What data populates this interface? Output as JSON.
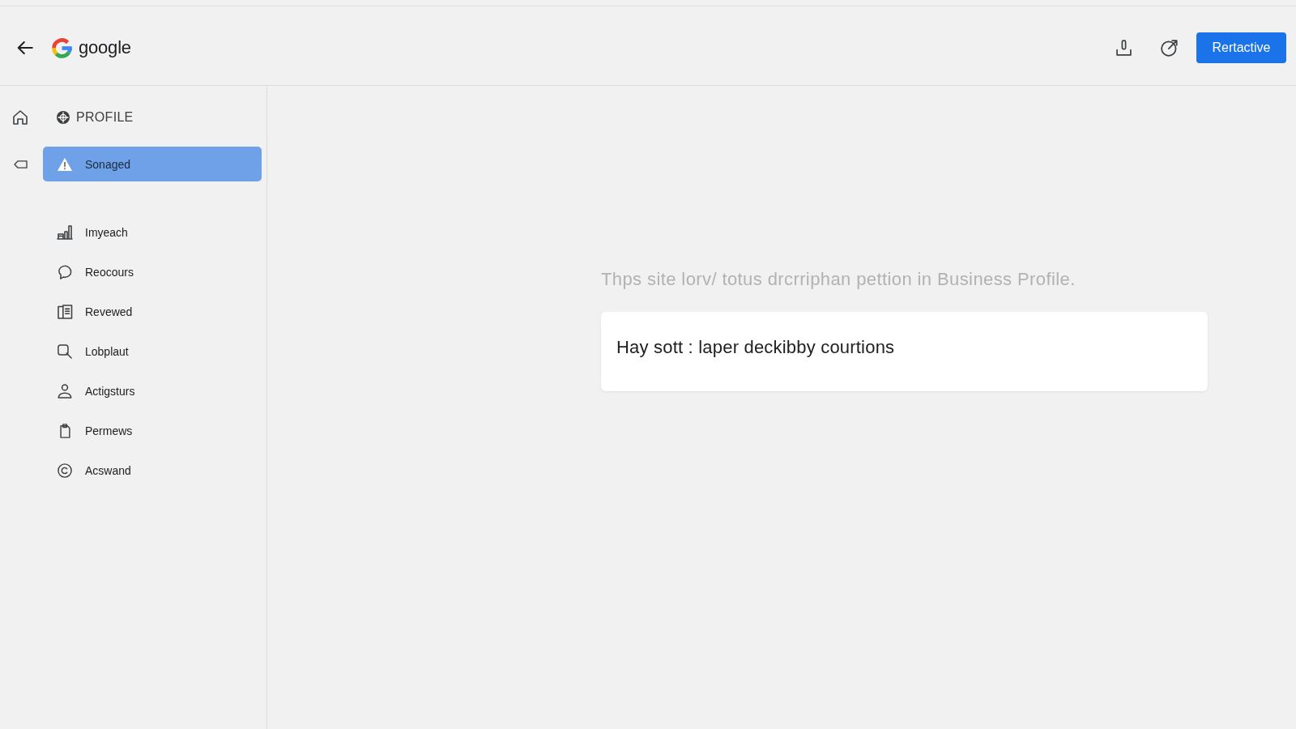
{
  "header": {
    "brand": "google",
    "primary_button": "Rertactive"
  },
  "sidebar": {
    "heading": "PROFILE",
    "items": [
      {
        "label": "Sonaged",
        "selected": true
      },
      {
        "label": "Imyeach",
        "selected": false
      },
      {
        "label": "Reocours",
        "selected": false
      },
      {
        "label": "Revewed",
        "selected": false
      },
      {
        "label": "Lobplaut",
        "selected": false
      },
      {
        "label": "Actigsturs",
        "selected": false
      },
      {
        "label": "Permews",
        "selected": false
      },
      {
        "label": "Acswand",
        "selected": false
      }
    ]
  },
  "main": {
    "description": "Thps site lorv/ totus drcrriphan pettion in Business Profile.",
    "card": {
      "text": "Hay sott : laper deckibby courtions"
    }
  }
}
